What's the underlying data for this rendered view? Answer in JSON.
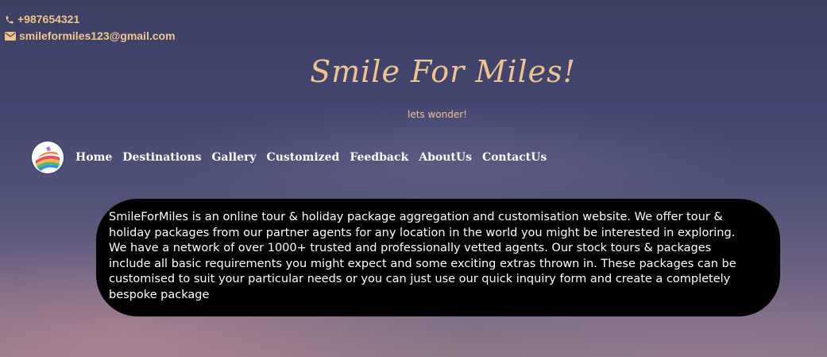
{
  "contact": {
    "phone": "+987654321",
    "email": "smileformiles123@gmail.com",
    "phone_icon": "phone-icon",
    "email_icon": "envelope-icon"
  },
  "header": {
    "title": "Smile For Miles!",
    "tagline": "lets wonder!"
  },
  "nav": {
    "logo_icon": "globe-logo-icon",
    "items": [
      {
        "label": "Home"
      },
      {
        "label": "Destinations"
      },
      {
        "label": "Gallery"
      },
      {
        "label": "Customized"
      },
      {
        "label": "Feedback"
      },
      {
        "label": "AboutUs"
      },
      {
        "label": "ContactUs"
      }
    ]
  },
  "about": {
    "text": "SmileForMiles is an online tour & holiday package aggregation and customisation website. We offer tour & holiday packages from our partner agents for any location in the world you might be interested in exploring. We have a network of over 1000+ trusted and professionally vetted agents. Our stock tours & packages include all basic requirements you might expect and some exciting extras thrown in. These packages can be customised to suit your particular needs or you can just use our quick inquiry form and create a completely bespoke package"
  },
  "colors": {
    "accent": "#f2c48d",
    "nav_text": "#ffffff",
    "box_bg": "#000000"
  }
}
